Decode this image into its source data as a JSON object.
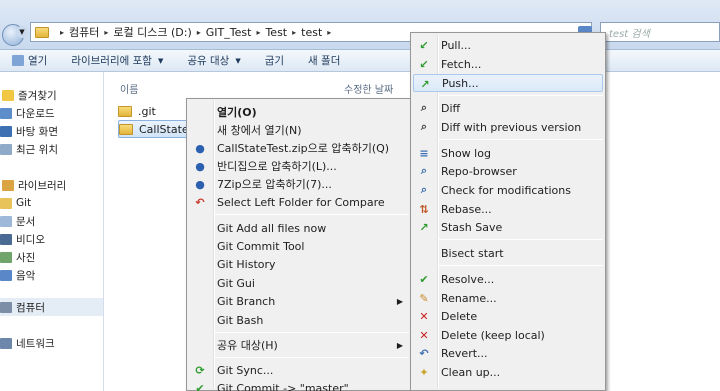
{
  "address": {
    "crumbs": [
      "컴퓨터",
      "로컬 디스크 (D:)",
      "GIT_Test",
      "Test",
      "test"
    ],
    "search_placeholder": "test 검색"
  },
  "toolbar": {
    "open": "열기",
    "include_library": "라이브러리에 포함",
    "share": "공유 대상",
    "burn": "굽기",
    "new_folder": "새 폴더"
  },
  "columns": {
    "name": "이름",
    "modified": "수정한 날짜"
  },
  "nav": {
    "favorites": "즐겨찾기",
    "downloads": "다운로드",
    "desktop": "바탕 화면",
    "recent": "최근 위치",
    "libraries": "라이브러리",
    "git": "Git",
    "documents": "문서",
    "videos": "비디오",
    "pictures": "사진",
    "music": "음악",
    "computer": "컴퓨터",
    "network": "네트워크"
  },
  "files": [
    ".git",
    "CallStateTest"
  ],
  "context_menu": {
    "items": [
      "열기(O)",
      "새 창에서 열기(N)",
      "CallStateTest.zip으로 압축하기(Q)",
      "반디집으로 압축하기(L)...",
      "7Zip으로 압축하기(7)...",
      "Select Left Folder for Compare",
      "Git Add all files now",
      "Git Commit Tool",
      "Git History",
      "Git Gui",
      "Git Branch",
      "Git Bash",
      "공유 대상(H)",
      "Git Sync...",
      "Git Commit -> \"master\""
    ]
  },
  "submenu": {
    "items": [
      "Pull...",
      "Fetch...",
      "Push...",
      "Diff",
      "Diff with previous version",
      "Show log",
      "Repo-browser",
      "Check for modifications",
      "Rebase...",
      "Stash Save",
      "Bisect start",
      "Resolve...",
      "Rename...",
      "Delete",
      "Delete (keep local)",
      "Revert...",
      "Clean up..."
    ]
  },
  "colors": {
    "pull": "#2e9b2e",
    "push": "#2e9b2e",
    "delete": "#cc2222"
  }
}
